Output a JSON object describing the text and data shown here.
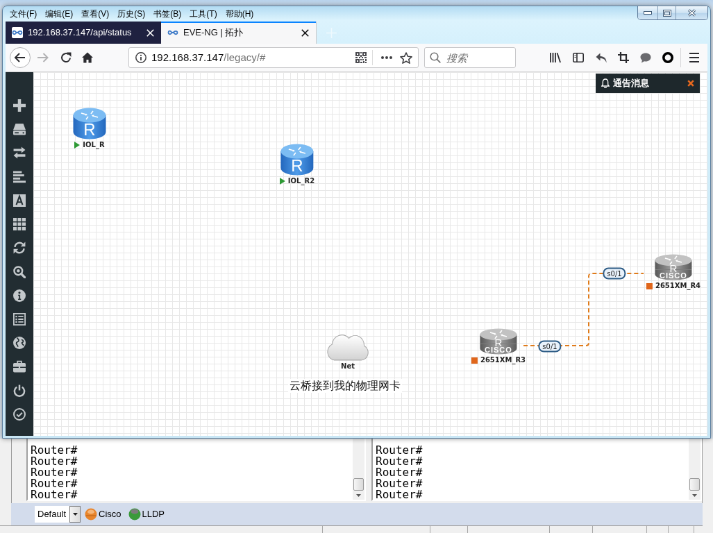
{
  "browser": {
    "menu": [
      "文件(F)",
      "编辑(E)",
      "查看(V)",
      "历史(S)",
      "书签(B)",
      "工具(T)",
      "帮助(H)"
    ],
    "tabs": [
      {
        "label": "192.168.37.147/api/status",
        "selected": false
      },
      {
        "label": "EVE-NG | 拓扑",
        "selected": true
      }
    ],
    "forward": {
      "disabled": true
    },
    "address": {
      "host": "192.168.37.147",
      "path": "/legacy/#"
    },
    "search": {
      "placeholder": "搜索"
    }
  },
  "notification": {
    "title": "通告消息"
  },
  "topology": {
    "nodes": [
      {
        "kind": "iol",
        "name": "IOL_R",
        "running": true,
        "icon_text": [
          "R"
        ]
      },
      {
        "kind": "iol",
        "name": "IOL_R2",
        "running": true,
        "icon_text": [
          "R"
        ]
      },
      {
        "kind": "cloud",
        "name": "Net"
      },
      {
        "kind": "dynamips",
        "name": "2651XM_R3",
        "running": false,
        "icon_text": [
          "R",
          "CISCO"
        ]
      },
      {
        "kind": "dynamips",
        "name": "2651XM_R4",
        "running": false,
        "icon_text": [
          "R",
          "CISCO"
        ]
      }
    ],
    "links": [
      {
        "labels": [
          "s0/1",
          "s0/1"
        ]
      }
    ],
    "notes": [
      "云桥接到我的物理网卡"
    ]
  },
  "terminal": {
    "panes": [
      {
        "lines": [
          "Router#",
          "Router#",
          "Router#",
          "Router#",
          "Router#"
        ]
      },
      {
        "lines": [
          "Router#",
          "Router#",
          "Router#",
          "Router#",
          "Router#"
        ]
      }
    ],
    "session": "Default",
    "buttons": [
      {
        "kind": "cisco",
        "label": "Cisco"
      },
      {
        "kind": "lldp",
        "label": "LLDP"
      }
    ]
  }
}
